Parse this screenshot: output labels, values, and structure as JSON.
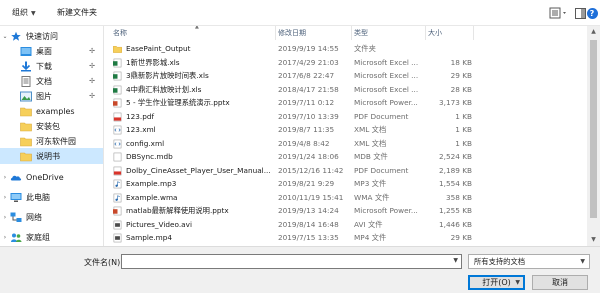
{
  "toolbar": {
    "organize_label": "组织",
    "new_folder_label": "新建文件夹"
  },
  "nav": {
    "items": [
      {
        "label": "快速访问",
        "icon": "star-icon",
        "expander": "⌄",
        "pinned": false,
        "selected": false,
        "level": 0
      },
      {
        "label": "桌面",
        "icon": "desktop-folder-icon",
        "expander": "",
        "pinned": true,
        "selected": false,
        "level": 1
      },
      {
        "label": "下载",
        "icon": "download-icon",
        "expander": "",
        "pinned": true,
        "selected": false,
        "level": 1
      },
      {
        "label": "文档",
        "icon": "documents-icon",
        "expander": "",
        "pinned": true,
        "selected": false,
        "level": 1
      },
      {
        "label": "图片",
        "icon": "pictures-icon",
        "expander": "",
        "pinned": true,
        "selected": false,
        "level": 1
      },
      {
        "label": "examples",
        "icon": "folder-icon",
        "expander": "",
        "pinned": false,
        "selected": false,
        "level": 1
      },
      {
        "label": "安装包",
        "icon": "folder-icon",
        "expander": "",
        "pinned": false,
        "selected": false,
        "level": 1
      },
      {
        "label": "河东软件园",
        "icon": "folder-icon",
        "expander": "",
        "pinned": false,
        "selected": false,
        "level": 1
      },
      {
        "label": "说明书",
        "icon": "folder-icon",
        "expander": "",
        "pinned": false,
        "selected": true,
        "level": 1
      },
      {
        "label": "OneDrive",
        "icon": "onedrive-icon",
        "expander": ">",
        "pinned": false,
        "selected": false,
        "level": 0
      },
      {
        "label": "此电脑",
        "icon": "computer-icon",
        "expander": ">",
        "pinned": false,
        "selected": false,
        "level": 0
      },
      {
        "label": "网络",
        "icon": "network-icon",
        "expander": ">",
        "pinned": false,
        "selected": false,
        "level": 0
      },
      {
        "label": "家庭组",
        "icon": "homegroup-icon",
        "expander": ">",
        "pinned": false,
        "selected": false,
        "level": 0
      }
    ]
  },
  "list": {
    "columns": {
      "name": "名称",
      "date": "修改日期",
      "type": "类型",
      "size": "大小"
    },
    "rows": [
      {
        "name": "EasePaint_Output",
        "date": "2019/9/19 14:55",
        "type": "文件夹",
        "size": "",
        "icon": "folder-icon"
      },
      {
        "name": "1新世界影城.xls",
        "date": "2017/4/29 21:03",
        "type": "Microsoft Excel ...",
        "size": "18 KB",
        "icon": "excel-icon"
      },
      {
        "name": "3鼎新影片放映时间表.xls",
        "date": "2017/6/8 22:47",
        "type": "Microsoft Excel ...",
        "size": "29 KB",
        "icon": "excel-icon"
      },
      {
        "name": "4中鼎汇料放映计划.xls",
        "date": "2018/4/17 21:58",
        "type": "Microsoft Excel ...",
        "size": "28 KB",
        "icon": "excel-icon"
      },
      {
        "name": "5 - 学生作业管理系统演示.pptx",
        "date": "2019/7/11 0:12",
        "type": "Microsoft Power...",
        "size": "3,173 KB",
        "icon": "powerpoint-icon"
      },
      {
        "name": "123.pdf",
        "date": "2019/7/10 13:39",
        "type": "PDF Document",
        "size": "1 KB",
        "icon": "pdf-icon"
      },
      {
        "name": "123.xml",
        "date": "2019/8/7 11:35",
        "type": "XML 文档",
        "size": "1 KB",
        "icon": "xml-icon"
      },
      {
        "name": "config.xml",
        "date": "2019/4/8 8:42",
        "type": "XML 文档",
        "size": "1 KB",
        "icon": "xml-icon"
      },
      {
        "name": "DBSync.mdb",
        "date": "2019/1/24 18:06",
        "type": "MDB 文件",
        "size": "2,524 KB",
        "icon": "mdb-file-icon"
      },
      {
        "name": "Dolby_CineAsset_Player_User_Manual...",
        "date": "2015/12/16 11:42",
        "type": "PDF Document",
        "size": "2,189 KB",
        "icon": "pdf-icon"
      },
      {
        "name": "Example.mp3",
        "date": "2019/8/21 9:29",
        "type": "MP3 文件",
        "size": "1,554 KB",
        "icon": "audio-icon"
      },
      {
        "name": "Example.wma",
        "date": "2010/11/19 15:41",
        "type": "WMA 文件",
        "size": "358 KB",
        "icon": "audio-icon"
      },
      {
        "name": "matlab最新解释使用说明.pptx",
        "date": "2019/9/13 14:24",
        "type": "Microsoft Power...",
        "size": "1,255 KB",
        "icon": "powerpoint-icon"
      },
      {
        "name": "Pictures_Video.avi",
        "date": "2019/8/14 16:48",
        "type": "AVI 文件",
        "size": "1,446 KB",
        "icon": "video-icon"
      },
      {
        "name": "Sample.mp4",
        "date": "2019/7/15 13:35",
        "type": "MP4 文件",
        "size": "29 KB",
        "icon": "video-icon"
      }
    ]
  },
  "bottom": {
    "filename_label": "文件名(N):",
    "filename_value": "",
    "filetype_value": "所有支持的文档",
    "open_label": "打开(O)",
    "cancel_label": "取消"
  }
}
